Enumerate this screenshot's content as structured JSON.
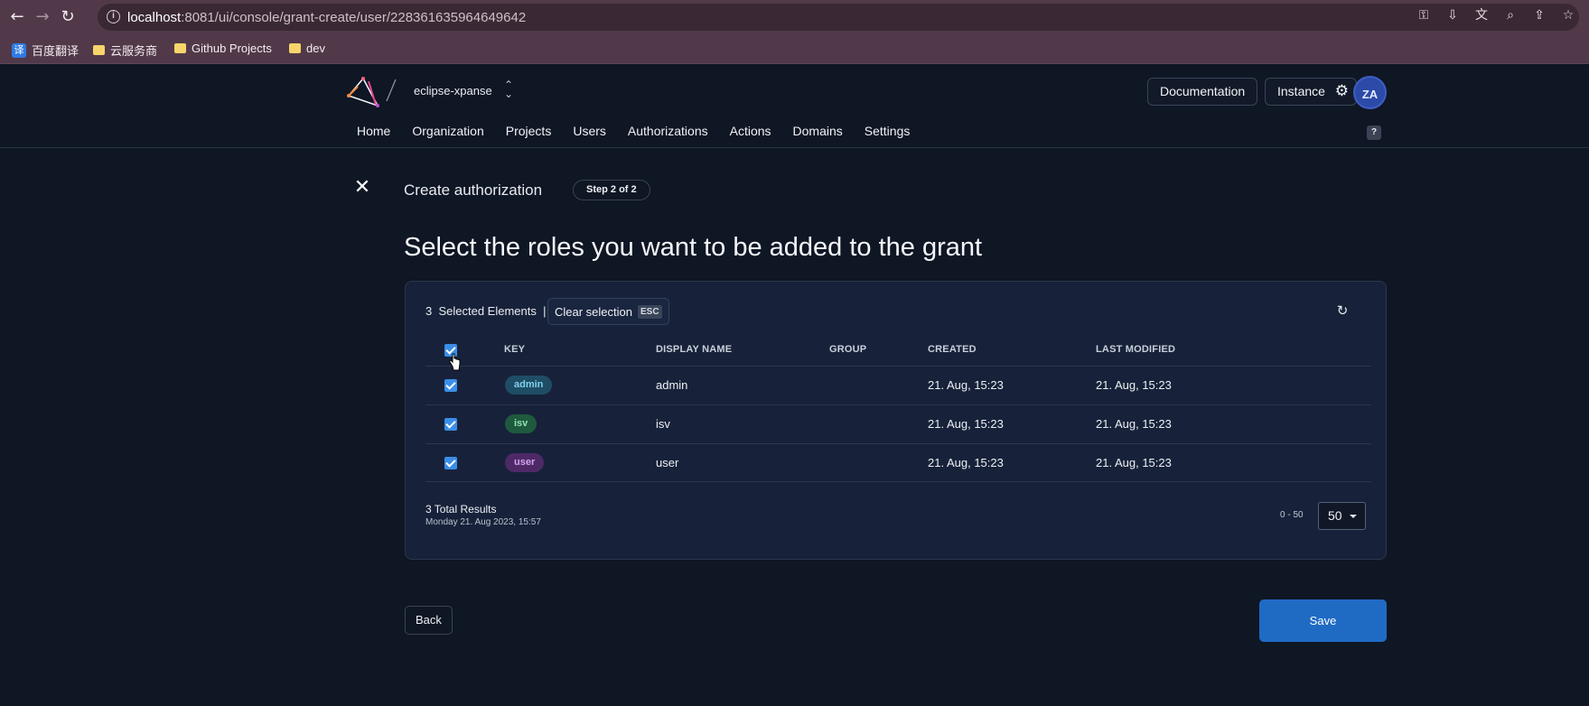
{
  "browser": {
    "url_host": "localhost",
    "url_rest": ":8081/ui/console/grant-create/user/228361635964649642",
    "bookmarks": [
      "百度翻译",
      "云服务商",
      "Github Projects",
      "dev"
    ]
  },
  "header": {
    "org_name": "eclipse-xpanse",
    "documentation_label": "Documentation",
    "instance_label": "Instance",
    "avatar_initials": "ZA",
    "help_label": "?",
    "nav": [
      "Home",
      "Organization",
      "Projects",
      "Users",
      "Authorizations",
      "Actions",
      "Domains",
      "Settings"
    ]
  },
  "page": {
    "crumb_title": "Create authorization",
    "step_badge": "Step 2 of 2",
    "title": "Select the roles you want to be added to the grant"
  },
  "table": {
    "selection_text": "3  Selected Elements  |",
    "clear_selection_label": "Clear selection",
    "clear_selection_key": "ESC",
    "columns": {
      "key": "KEY",
      "display_name": "DISPLAY NAME",
      "group": "GROUP",
      "created": "CREATED",
      "last_modified": "LAST MODIFIED"
    },
    "rows": [
      {
        "key": "admin",
        "display_name": "admin",
        "group": "",
        "created": "21. Aug, 15:23",
        "last_modified": "21. Aug, 15:23",
        "checked": true,
        "pill_bg": "#1f4d66",
        "pill_fg": "#7fd0ee"
      },
      {
        "key": "isv",
        "display_name": "isv",
        "group": "",
        "created": "21. Aug, 15:23",
        "last_modified": "21. Aug, 15:23",
        "checked": true,
        "pill_bg": "#1f5a3e",
        "pill_fg": "#8fe0b2"
      },
      {
        "key": "user",
        "display_name": "user",
        "group": "",
        "created": "21. Aug, 15:23",
        "last_modified": "21. Aug, 15:23",
        "checked": true,
        "pill_bg": "#4d2a66",
        "pill_fg": "#d4a3f4"
      }
    ],
    "total_results": "3 Total Results",
    "timestamp": "Monday 21. Aug 2023, 15:57",
    "range": "0 - 50",
    "page_size": "50"
  },
  "footer": {
    "back_label": "Back",
    "save_label": "Save"
  },
  "colors": {
    "accent": "#1f6bc4",
    "checkbox": "#3b8ee8",
    "background": "#0f1624",
    "card": "#17223a"
  }
}
